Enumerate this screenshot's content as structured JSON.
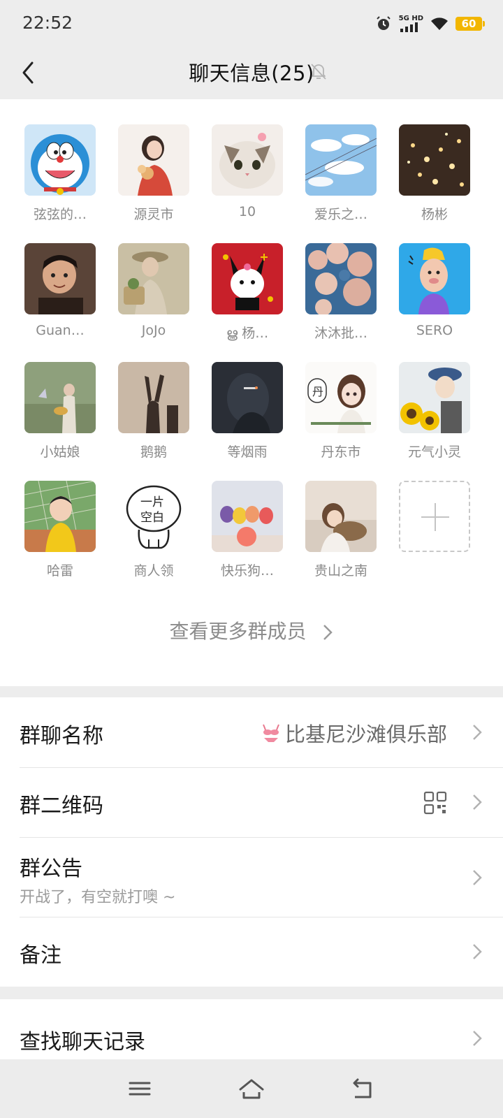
{
  "status_bar": {
    "time": "22:52",
    "network": "5G HD",
    "battery": "60",
    "icons": [
      "alarm-icon",
      "signal-icon",
      "wifi-icon",
      "battery-icon"
    ]
  },
  "nav": {
    "title": "聊天信息(25)",
    "back_icon": "chevron-left-icon",
    "mute_icon": "bell-off-icon"
  },
  "members": [
    {
      "name": "弦弦的…",
      "avatar": "doraemon"
    },
    {
      "name": "源灵市",
      "avatar": "girl-flowers"
    },
    {
      "name": "10",
      "avatar": "cat"
    },
    {
      "name": "爱乐之…",
      "avatar": "sky"
    },
    {
      "name": "杨彬",
      "avatar": "lights"
    },
    {
      "name": "Guan…",
      "avatar": "child"
    },
    {
      "name": "JoJo",
      "avatar": "girl-hat"
    },
    {
      "name": "ൠ 杨…",
      "avatar": "kuromi"
    },
    {
      "name": "沐沐批…",
      "avatar": "blossoms"
    },
    {
      "name": "SERO",
      "avatar": "cartoon"
    },
    {
      "name": "小姑娘",
      "avatar": "girl-beach"
    },
    {
      "name": "鹅鹅",
      "avatar": "shadow"
    },
    {
      "name": "等烟雨",
      "avatar": "dark"
    },
    {
      "name": "丹东市",
      "avatar": "anime-girl"
    },
    {
      "name": "元气小灵",
      "avatar": "sunflowers"
    },
    {
      "name": "哈雷",
      "avatar": "toddler"
    },
    {
      "name": "商人领",
      "avatar": "blank-sketch"
    },
    {
      "name": "快乐狗…",
      "avatar": "dolls"
    },
    {
      "name": "贵山之南",
      "avatar": "girl-dog"
    }
  ],
  "blank_avatar_text": [
    "一片",
    "空白"
  ],
  "add_member_icon": "plus-icon",
  "view_more": "查看更多群成员",
  "settings": {
    "group_name_label": "群聊名称",
    "group_name_value": "比基尼沙滩俱乐部",
    "qr_label": "群二维码",
    "announcement_label": "群公告",
    "announcement_text": "开战了，有空就打噢 ~",
    "remark_label": "备注",
    "search_label": "查找聊天记录"
  },
  "system_nav": [
    "menu-icon",
    "home-icon",
    "back-icon"
  ],
  "colors": {
    "background": "#ededed",
    "panel": "#ffffff",
    "battery": "#f2b600",
    "secondary_text": "#8a8a8a"
  }
}
